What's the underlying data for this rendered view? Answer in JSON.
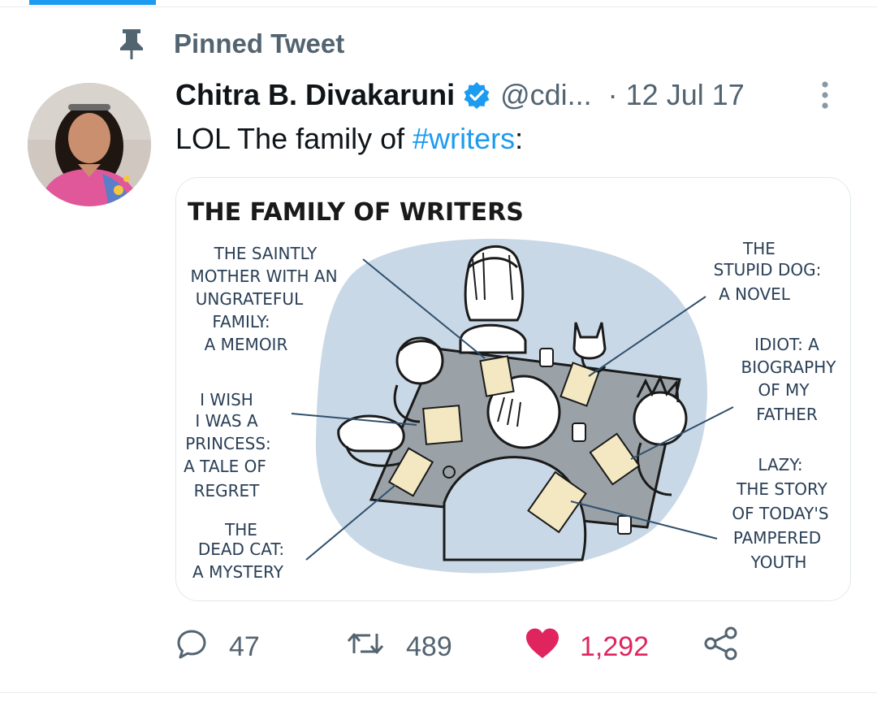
{
  "pinned": {
    "label": "Pinned Tweet"
  },
  "author": {
    "display_name": "Chitra B. Divakaruni",
    "handle": "@cdi...",
    "date": "· 12 Jul 17"
  },
  "tweet": {
    "text_prefix": "LOL The family of ",
    "hashtag": "#writers",
    "text_suffix": ":"
  },
  "media": {
    "title": "THE FAMILY OF WRITERS",
    "captions": {
      "saintly_mother": [
        "THE SAINTLY",
        "MOTHER WITH AN",
        "UNGRATEFUL",
        "FAMILY:",
        "A MEMOIR"
      ],
      "princess": [
        "I WISH",
        "I WAS A",
        "PRINCESS:",
        "A TALE OF",
        "REGRET"
      ],
      "dead_cat": [
        "THE",
        "DEAD CAT:",
        "A MYSTERY"
      ],
      "stupid_dog": [
        "THE",
        "STUPID DOG:",
        "A NOVEL"
      ],
      "idiot": [
        "IDIOT: A",
        "BIOGRAPHY",
        "OF MY",
        "FATHER"
      ],
      "lazy": [
        "LAZY:",
        "THE STORY",
        "OF TODAY'S",
        "PAMPERED",
        "YOUTH"
      ]
    }
  },
  "actions": {
    "reply_count": "47",
    "retweet_count": "489",
    "like_count": "1,292"
  },
  "icons": {
    "pin": "pin-icon",
    "verified": "verified-badge-icon",
    "more": "more-vertical-icon",
    "reply": "reply-icon",
    "retweet": "retweet-icon",
    "like": "heart-icon",
    "share": "share-icon"
  },
  "colors": {
    "accent": "#1d9bf0",
    "like": "#e0245e",
    "secondary_text": "#536471"
  }
}
